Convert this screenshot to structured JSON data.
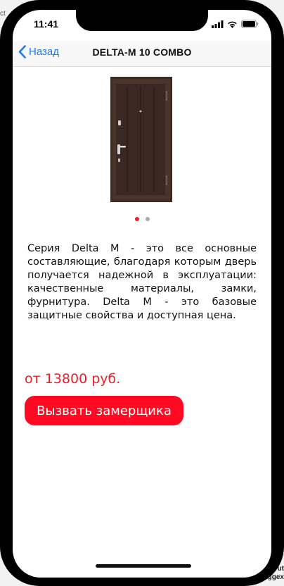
{
  "status_bar": {
    "time": "11:41"
  },
  "nav": {
    "back_label": "Назад",
    "title": "DELTA-M 10 COMBO"
  },
  "product": {
    "image_icon": "door-image",
    "pager_total": 2,
    "pager_active": 1
  },
  "content": {
    "description": "Серия Delta M - это все основные составляющие, благодаря которым дверь получается надежной в эксплуатации: качественные материалы, замки, фурнитура. Delta M - это базовые защитные свойства и доступная цена.",
    "price": "от 13800 руб.",
    "cta_label": "Вызвать замерщика"
  },
  "background": {
    "left_fragment": "ct",
    "right_fragment_1": "ut",
    "right_fragment_2": "ggex"
  },
  "colors": {
    "accent": "#e8202a",
    "button": "#ff0a22",
    "link": "#1a7cf0"
  }
}
